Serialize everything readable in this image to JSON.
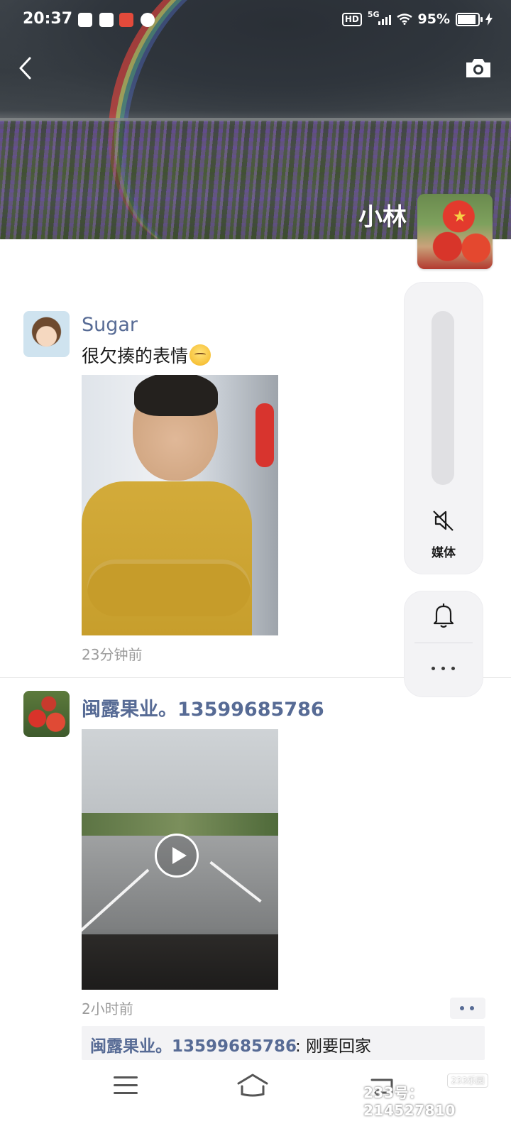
{
  "status_bar": {
    "time": "20:37",
    "network": "5G",
    "hd": "HD",
    "battery": "95%",
    "battery_level": 0.95
  },
  "header": {
    "back_icon": "chevron-left-icon",
    "camera_icon": "camera-icon",
    "username": "小林"
  },
  "feed": [
    {
      "author": "Sugar",
      "text": "很欠揍的表情",
      "time": "23分钟前"
    },
    {
      "author": "闽露果业。13599685786",
      "time": "2小时前",
      "comment_author": "闽露果业。13599685786",
      "comment_text": ": 刚要回家"
    }
  ],
  "side_panel": {
    "media_label": "媒体",
    "mute_icon": "speaker-mute-icon",
    "bell_icon": "bell-icon",
    "more_icon": "more-dots-icon"
  },
  "watermark": {
    "text": "233号：214527810",
    "logo": "233乐园"
  }
}
